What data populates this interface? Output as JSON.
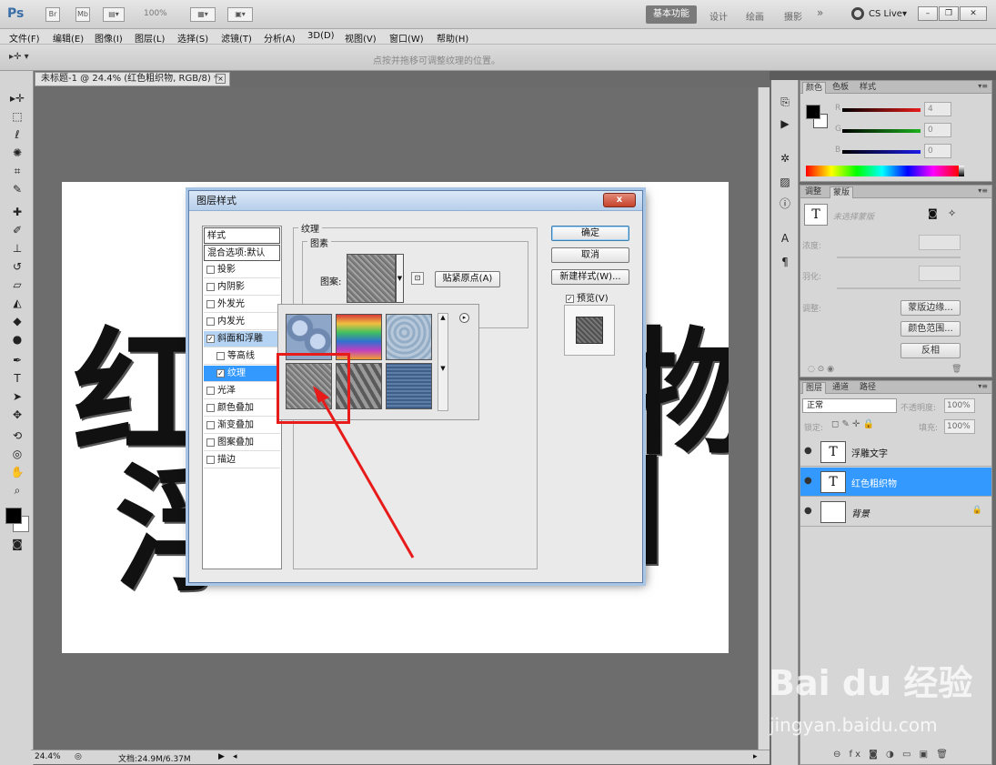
{
  "app": {
    "logo": "Ps",
    "zoom_select": "100%",
    "workspaces": [
      "基本功能",
      "设计",
      "绘画",
      "摄影"
    ],
    "workspace_more": "»",
    "cs_live": "CS Live",
    "cs_live_arrow": "▾"
  },
  "menu": [
    "文件(F)",
    "编辑(E)",
    "图像(I)",
    "图层(L)",
    "选择(S)",
    "滤镜(T)",
    "分析(A)",
    "3D(D)",
    "视图(V)",
    "窗口(W)",
    "帮助(H)"
  ],
  "options": {
    "tool_icon": "▸✛ ▾",
    "hint": "点按并拖移可调整纹理的位置。"
  },
  "document": {
    "tab_title": "未标题-1 @ 24.4% (红色粗织物, RGB/8) *",
    "close": "×",
    "canvas_line1": "红",
    "canvas_line1_right": "物",
    "canvas_line2": "浮"
  },
  "status": {
    "zoom": "24.4%",
    "doc_info": "文档:24.9M/6.37M"
  },
  "dialog": {
    "title": "图层样式",
    "close": "x",
    "style_list": [
      {
        "label": "样式",
        "type": "head"
      },
      {
        "label": "混合选项:默认",
        "type": "head"
      },
      {
        "label": "投影",
        "checked": false
      },
      {
        "label": "内阴影",
        "checked": false
      },
      {
        "label": "外发光",
        "checked": false
      },
      {
        "label": "内发光",
        "checked": false
      },
      {
        "label": "斜面和浮雕",
        "checked": true
      },
      {
        "label": "等高线",
        "checked": false,
        "sub": true
      },
      {
        "label": "纹理",
        "checked": true,
        "sub": true
      },
      {
        "label": "光泽",
        "checked": false
      },
      {
        "label": "颜色叠加",
        "checked": false
      },
      {
        "label": "渐变叠加",
        "checked": false
      },
      {
        "label": "图案叠加",
        "checked": false
      },
      {
        "label": "描边",
        "checked": false
      }
    ],
    "section_title": "纹理",
    "elements_title": "图素",
    "pattern_label": "图案:",
    "snap_origin": "贴紧原点(A)",
    "ok": "确定",
    "cancel": "取消",
    "new_style": "新建样式(W)...",
    "preview": "预览(V)",
    "check": "✓"
  },
  "picker": {
    "patterns": [
      {
        "name": "bubbles",
        "color": "#8ea6c8"
      },
      {
        "name": "tie-dye",
        "color": "#e0a030"
      },
      {
        "name": "ice",
        "color": "#9ab2cc"
      },
      {
        "name": "gray-granite",
        "color": "#8a8a8a"
      },
      {
        "name": "weave",
        "color": "#6e6e6e"
      },
      {
        "name": "blue-fabric",
        "color": "#4a6a94"
      }
    ],
    "menu_arrow": "▸"
  },
  "color_panel": {
    "tabs": [
      "颜色",
      "色板",
      "样式"
    ],
    "r_label": "R",
    "g_label": "G",
    "b_label": "B",
    "r": "4",
    "g": "0",
    "b": "0",
    "colors": {
      "red": "#e81b1b",
      "green": "#1bb11b",
      "blue": "#1b1be8"
    }
  },
  "masks_panel": {
    "tabs": [
      "调整",
      "蒙版"
    ],
    "no_selection": "未选择蒙版",
    "density": "浓度:",
    "feather": "羽化:",
    "refine": "调整:",
    "mask_edge": "蒙版边缘...",
    "color_range": "颜色范围...",
    "invert": "反相"
  },
  "layers_panel": {
    "tabs": [
      "图层",
      "通道",
      "路径"
    ],
    "blend_mode": "正常",
    "opacity_label": "不透明度:",
    "opacity": "100%",
    "lock_label": "锁定:",
    "fill_label": "填充:",
    "fill": "100%",
    "layers": [
      {
        "name": "浮雕文字",
        "type": "text",
        "selected": false
      },
      {
        "name": "红色粗织物",
        "type": "text",
        "selected": true
      },
      {
        "name": "背景",
        "type": "bg",
        "selected": false
      }
    ],
    "eye": "●",
    "text_thumb": "T",
    "lock": "🔒"
  },
  "watermark": {
    "main": "Bai du 经验",
    "sub": "jingyan.baidu.com"
  }
}
